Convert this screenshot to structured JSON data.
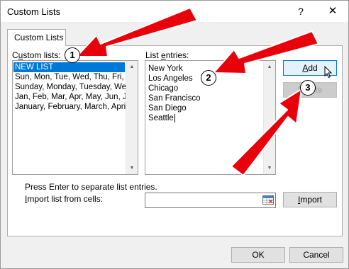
{
  "window": {
    "title": "Custom Lists",
    "help": "?",
    "close": "✕"
  },
  "tab": {
    "label": "Custom Lists"
  },
  "custom_lists": {
    "label_prefix": "C",
    "label_underlined": "u",
    "label_suffix": "stom lists:",
    "items": [
      "NEW LIST",
      "Sun, Mon, Tue, Wed, Thu, Fri, S",
      "Sunday, Monday, Tuesday, We",
      "Jan, Feb, Mar, Apr, May, Jun, J",
      "January, February, March, Apri"
    ],
    "selected_index": 0
  },
  "list_entries": {
    "label_prefix": "List ",
    "label_underlined": "e",
    "label_suffix": "ntries:",
    "lines": [
      "New York",
      "Los Angeles",
      "Chicago",
      "San Francisco",
      "San Diego",
      "Seattle"
    ]
  },
  "buttons": {
    "add_prefix": "",
    "add_underlined": "A",
    "add_suffix": "dd",
    "delete": "Delete",
    "import_prefix": "",
    "import_underlined": "I",
    "import_suffix": "mport",
    "ok": "OK",
    "cancel": "Cancel"
  },
  "hint": "Press Enter to separate list entries.",
  "import": {
    "label_prefix": "",
    "label_underlined": "I",
    "label_suffix": "mport list from cells:",
    "value": ""
  },
  "annotations": {
    "badges": [
      "1",
      "2",
      "3"
    ],
    "arrow_color": "#e8000b"
  },
  "colors": {
    "selection": "#0078d7",
    "focus_border": "#0078d7"
  }
}
